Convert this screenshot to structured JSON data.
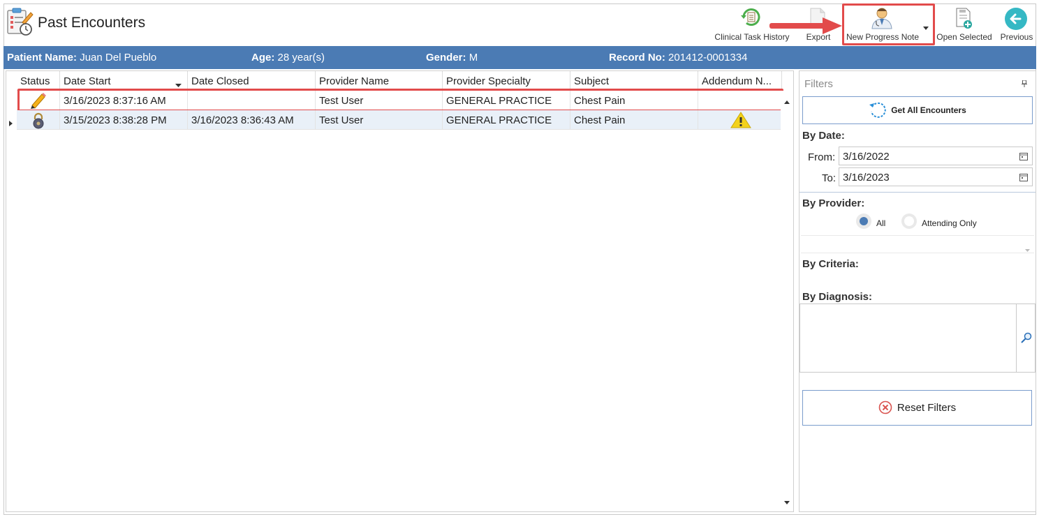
{
  "header": {
    "title": "Past Encounters"
  },
  "toolbar": {
    "clinical_task_history": "Clinical Task History",
    "export": "Export",
    "new_progress_note": "New Progress Note",
    "open_selected": "Open Selected",
    "previous": "Previous"
  },
  "patient": {
    "name_label": "Patient Name:",
    "name_value": "Juan Del Pueblo",
    "age_label": "Age:",
    "age_value": "28 year(s)",
    "gender_label": "Gender:",
    "gender_value": "M",
    "record_label": "Record No:",
    "record_value": "201412-0001334"
  },
  "grid": {
    "columns": [
      "Status",
      "Date Start",
      "Date Closed",
      "Provider Name",
      "Provider Specialty",
      "Subject",
      "Addendum N..."
    ],
    "rows": [
      {
        "status": "pencil-icon",
        "date_start": "3/16/2023 8:37:16 AM",
        "date_closed": "",
        "provider_name": "Test User",
        "provider_specialty": "GENERAL PRACTICE",
        "subject": "Chest Pain",
        "addendum": ""
      },
      {
        "status": "lock-icon",
        "date_start": "3/15/2023 8:38:28 PM",
        "date_closed": "3/16/2023 8:36:43 AM",
        "provider_name": "Test User",
        "provider_specialty": "GENERAL PRACTICE",
        "subject": "Chest Pain",
        "addendum": "warning-icon"
      }
    ]
  },
  "filters": {
    "title": "Filters",
    "get_all": "Get All Encounters",
    "by_date": "By Date:",
    "from_label": "From:",
    "from_value": "3/16/2022",
    "to_label": "To:",
    "to_value": "3/16/2023",
    "by_provider": "By Provider:",
    "all": "All",
    "attending_only": "Attending Only",
    "by_criteria": "By Criteria:",
    "by_diagnosis": "By Diagnosis:",
    "reset": "Reset Filters"
  },
  "colors": {
    "patient_bar": "#4b7bb4",
    "highlight": "#e24b4b",
    "selected_row": "#e9f0f8"
  }
}
